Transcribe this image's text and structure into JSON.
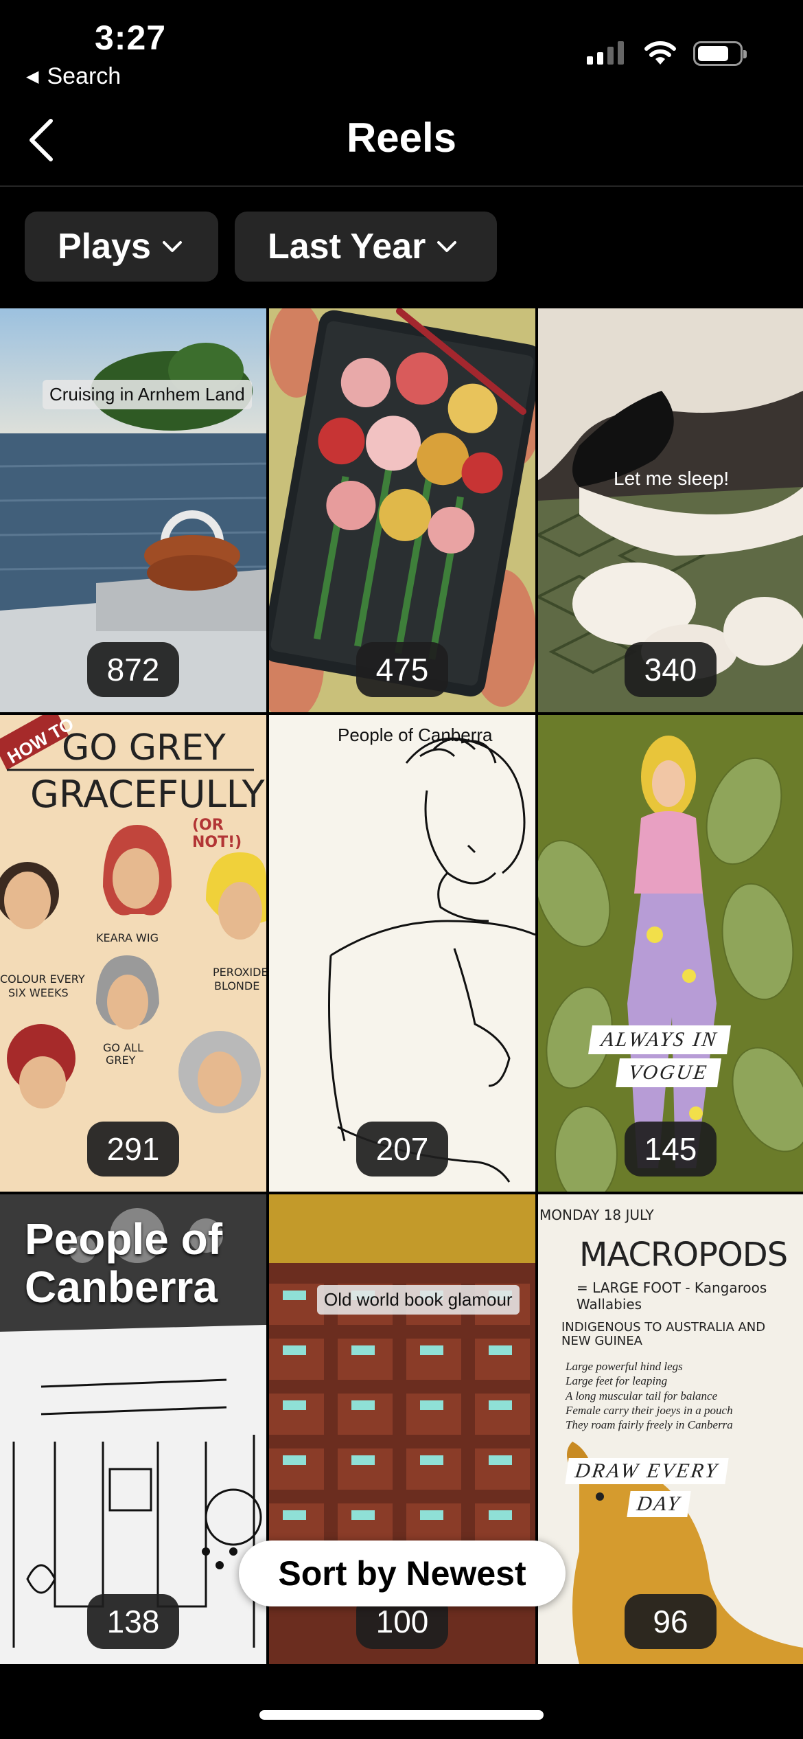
{
  "status": {
    "time": "3:27",
    "back_label": "Search"
  },
  "nav": {
    "title": "Reels"
  },
  "filters": [
    {
      "label": "Plays"
    },
    {
      "label": "Last Year"
    }
  ],
  "reels": [
    {
      "count": "872",
      "caption": "Cruising in Arnhem Land"
    },
    {
      "count": "475",
      "caption": ""
    },
    {
      "count": "340",
      "caption": "Let me sleep!"
    },
    {
      "count": "291",
      "caption": ""
    },
    {
      "count": "207",
      "caption": "People of Canberra"
    },
    {
      "count": "145",
      "caption": ""
    },
    {
      "count": "138",
      "caption": ""
    },
    {
      "count": "100",
      "caption": "Old world book glamour"
    },
    {
      "count": "96",
      "caption": ""
    }
  ],
  "artwork_text": {
    "go_grey_title_1": "GO GREY",
    "go_grey_title_2": "GRACEFULLY",
    "go_grey_note": "(OR NOT!)",
    "go_grey_banner": "HOW TO",
    "vogue_1": "ALWAYS IN",
    "vogue_2": "VOGUE",
    "people_big_1": "People of",
    "people_big_2": "Canberra",
    "macro_date": "MONDAY 18 JULY",
    "macro_title": "MACROPODS",
    "macro_sub": "= LARGE FOOT - Kangaroos Wallabies",
    "macro_indig": "INDIGENOUS TO AUSTRALIA AND NEW GUINEA",
    "macro_b1": "Large powerful hind legs",
    "macro_b2": "Large feet for leaping",
    "macro_b3": "A long muscular tail for balance",
    "macro_b4": "Female carry their joeys in a pouch",
    "macro_b5": "They roam fairly freely in Canberra",
    "draw_1": "DRAW EVERY",
    "draw_2": "DAY"
  },
  "sort_button": {
    "label": "Sort by Newest"
  },
  "colors": {
    "background": "#000000",
    "chip": "#262626",
    "accent": "#ffffff"
  }
}
